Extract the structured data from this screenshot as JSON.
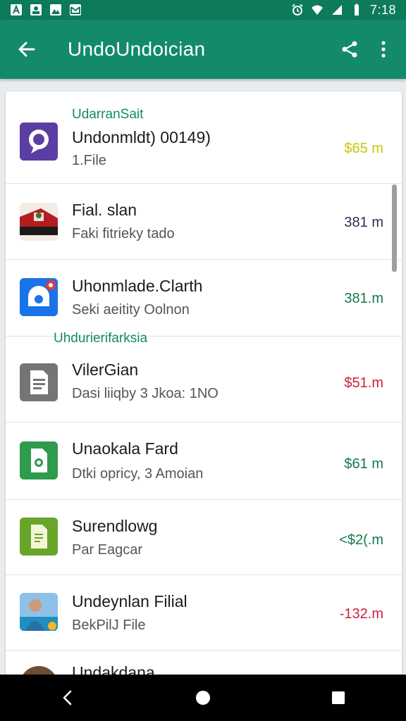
{
  "status_bar": {
    "time": "7:18",
    "left_icons": [
      "a-icon",
      "photo-icon",
      "image-icon",
      "mail-icon"
    ],
    "right_icons": [
      "alarm-icon",
      "wifi-icon",
      "signal-icon",
      "battery-icon"
    ]
  },
  "app_bar": {
    "title": "UndoUndoician",
    "icons": [
      "back-arrow-icon",
      "share-icon",
      "more-vert-icon"
    ]
  },
  "sections": [
    {
      "label": "UdarranSait"
    },
    {
      "label": "Uhdurierifarksia"
    }
  ],
  "rows": [
    {
      "title": "Undonmldt) 00149)",
      "subtitle": "1.File",
      "amount": "$65 m",
      "amount_color": "#c8c800",
      "icon": "chat-bubble-icon"
    },
    {
      "title": "Fial. slan",
      "subtitle": "Faki fitrieky tado",
      "amount": "381 m",
      "amount_color": "#2a2f55",
      "icon": "photo-thumbnail-icon"
    },
    {
      "title": "Uhonmlade.Clarth",
      "subtitle": "Seki aeitity Oolnon",
      "amount": "381.m",
      "amount_color": "#137a4a",
      "icon": "camera-app-icon"
    },
    {
      "title": "VilerGian",
      "subtitle": "Dasi liiqby 3 Jkoa: 1NO",
      "amount": "$51.m",
      "amount_color": "#d21d3b",
      "icon": "document-icon"
    },
    {
      "title": "Unaokala Fard",
      "subtitle": "Dtki opricy, 3 Amoian",
      "amount": "$61 m",
      "amount_color": "#137a4a",
      "icon": "green-file-icon"
    },
    {
      "title": "Surendlowg",
      "subtitle": "Par Eagcar",
      "amount": "<$2(.m",
      "amount_color": "#137a4a",
      "icon": "sheet-file-icon"
    },
    {
      "title": "Undeynlan Filial",
      "subtitle": "BekPilJ File",
      "amount": "-132.m",
      "amount_color": "#d21d3b",
      "icon": "person-photo-icon"
    },
    {
      "title": "Undakdana",
      "subtitle": "",
      "amount": "",
      "amount_color": "#137a4a",
      "icon": "avatar-icon"
    }
  ],
  "nav_bar": {
    "icons": [
      "nav-back-icon",
      "nav-home-icon",
      "nav-recents-icon"
    ]
  }
}
